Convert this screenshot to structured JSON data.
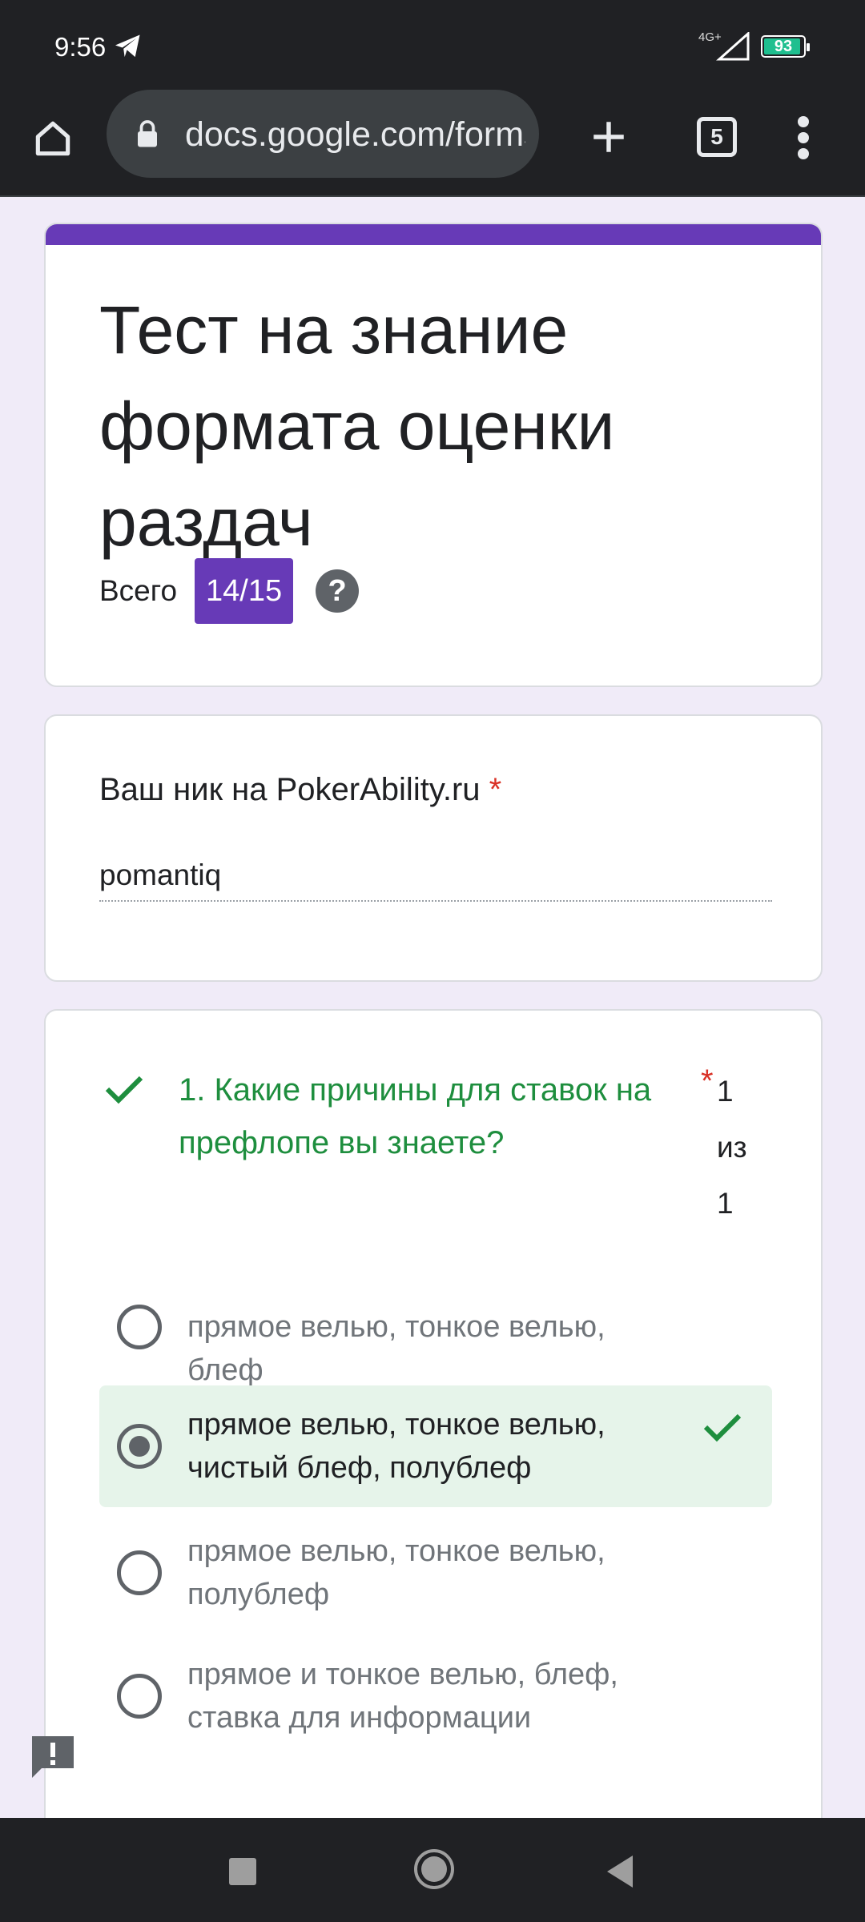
{
  "status_bar": {
    "time": "9:56",
    "network": "4G+",
    "battery": "93",
    "battery_level": 0.93,
    "icons": [
      "telegram-icon",
      "signal-icon",
      "battery-icon"
    ]
  },
  "browser": {
    "url": "docs.google.com/forms",
    "tab_count": "5",
    "icons": [
      "home-icon",
      "lock-icon",
      "plus-icon",
      "tabs-icon",
      "more-vert-icon"
    ]
  },
  "form": {
    "title": "Тест на знание формата оценки раздач",
    "score_label": "Всего",
    "score_value": "14/15",
    "help_symbol": "?"
  },
  "nick_question": {
    "label": "Ваш ник на PokerAbility.ru",
    "required_mark": "*",
    "answer": "pomantiq"
  },
  "question_1": {
    "text": "1. Какие причины для ставок на префлопе вы знаете?",
    "required_mark": "*",
    "points_earned": "1",
    "points_sep": "из",
    "points_total": "1",
    "options": [
      {
        "label": "прямое велью, тонкое велью, блеф",
        "selected": false,
        "correct": false
      },
      {
        "label": "прямое велью, тонкое велью, чистый блеф, полублеф",
        "selected": true,
        "correct": true
      },
      {
        "label": "прямое велью, тонкое велью, полублеф",
        "selected": false,
        "correct": false
      },
      {
        "label": "прямое и тонкое велью, блеф, ставка для информации",
        "selected": false,
        "correct": false
      }
    ]
  },
  "colors": {
    "accent": "#673ab7",
    "correct": "#1e8e3e",
    "correct_bg": "#e6f4ea",
    "required": "#d93025",
    "page_bg": "#f0ebf8"
  }
}
